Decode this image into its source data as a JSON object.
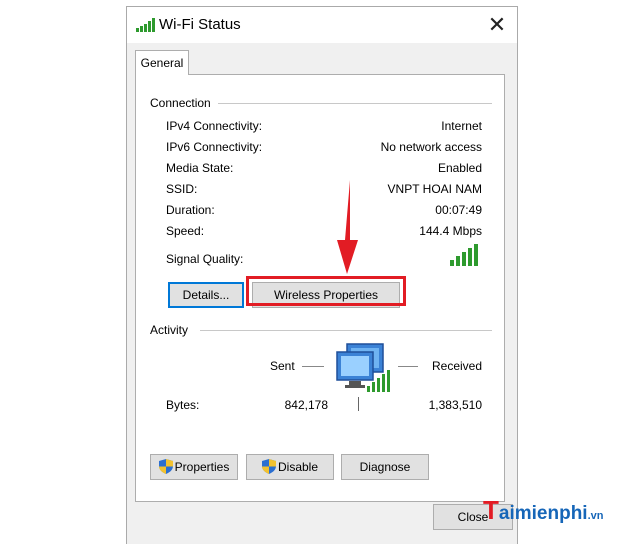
{
  "window": {
    "title": "Wi-Fi Status",
    "close_glyph": "✕"
  },
  "tabs": [
    {
      "label": "General"
    }
  ],
  "connection": {
    "label": "Connection",
    "rows": [
      {
        "label": "IPv4 Connectivity:",
        "value": "Internet"
      },
      {
        "label": "IPv6 Connectivity:",
        "value": "No network access"
      },
      {
        "label": "Media State:",
        "value": "Enabled"
      },
      {
        "label": "SSID:",
        "value": "VNPT HOAI NAM"
      },
      {
        "label": "Duration:",
        "value": "00:07:49"
      },
      {
        "label": "Speed:",
        "value": "144.4 Mbps"
      }
    ],
    "signal_quality_label": "Signal Quality:",
    "signal_bars": 5
  },
  "buttons": {
    "details": "Details...",
    "wireless_properties": "Wireless Properties",
    "properties": "Properties",
    "disable": "Disable",
    "diagnose": "Diagnose",
    "close": "Close"
  },
  "activity": {
    "label": "Activity",
    "sent_label": "Sent",
    "received_label": "Received",
    "bytes_label": "Bytes:",
    "bytes_sent": "842,178",
    "bytes_received": "1,383,510"
  },
  "watermark": {
    "letter": "T",
    "text": "aimienphi",
    "suffix": ".vn"
  },
  "colors": {
    "signal": "#2e9a2e",
    "highlight": "#e21c24",
    "default_border": "#0078d7",
    "brand": "#1666b8"
  },
  "icons": [
    "wifi-signal-icon",
    "network-computers-icon",
    "uac-shield-icon",
    "red-arrow-icon"
  ]
}
